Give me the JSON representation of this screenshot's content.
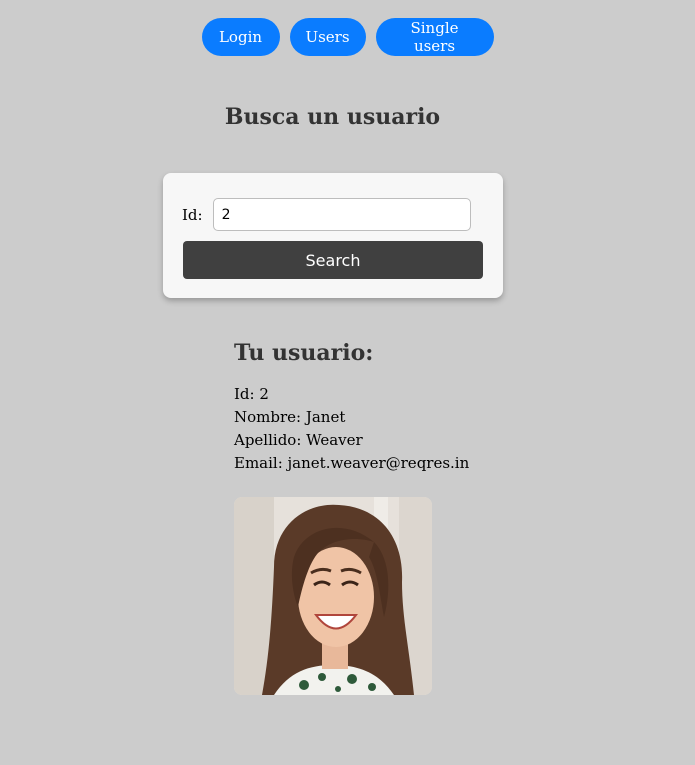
{
  "nav": {
    "login_label": "Login",
    "users_label": "Users",
    "single_users_label": "Single users",
    "accent_color": "#0a7cff"
  },
  "search": {
    "title": "Busca un usuario",
    "id_label": "Id:",
    "id_value": "2",
    "button_label": "Search"
  },
  "user": {
    "heading": "Tu usuario:",
    "id_line": "Id: 2",
    "nombre_line": "Nombre: Janet",
    "apellido_line": "Apellido: Weaver",
    "email_line": "Email: janet.weaver@reqres.in",
    "avatar_icon": "user-photo"
  }
}
